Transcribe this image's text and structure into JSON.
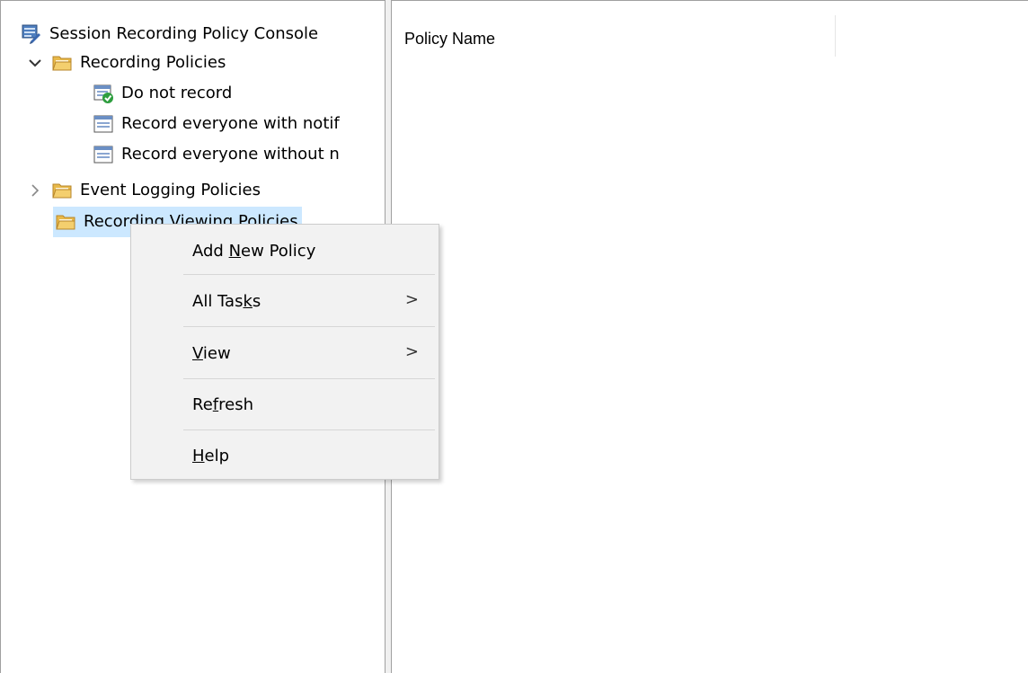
{
  "tree": {
    "root": {
      "label": "Session Recording Policy Console",
      "icon": "console-icon"
    },
    "items": [
      {
        "label": "Recording Policies",
        "expander": "expanded",
        "icon": "folder-icon"
      },
      {
        "label": "Do not record",
        "icon": "policy-active-icon"
      },
      {
        "label": "Record everyone with notif",
        "icon": "policy-icon"
      },
      {
        "label": "Record everyone without n",
        "icon": "policy-icon"
      },
      {
        "label": "Event Logging Policies",
        "expander": "collapsed",
        "icon": "folder-icon"
      },
      {
        "label": "Recording Viewing Policies",
        "icon": "folder-icon",
        "selected": true
      }
    ]
  },
  "list": {
    "columns": [
      "Policy Name"
    ]
  },
  "context_menu": {
    "items": [
      {
        "pre": "Add ",
        "key": "N",
        "post": "ew Policy",
        "submenu": false
      },
      {
        "pre": "All Tas",
        "key": "k",
        "post": "s",
        "submenu": true
      },
      {
        "pre": "",
        "key": "V",
        "post": "iew",
        "submenu": true
      },
      {
        "pre": "Re",
        "key": "f",
        "post": "resh",
        "submenu": false
      },
      {
        "pre": "",
        "key": "H",
        "post": "elp",
        "submenu": false
      }
    ],
    "submenu_glyph": ">"
  },
  "colors": {
    "selection": "#cce8ff",
    "menu_bg": "#f2f2f2",
    "folder": "#e8b94a",
    "check": "#2e9e3e"
  }
}
